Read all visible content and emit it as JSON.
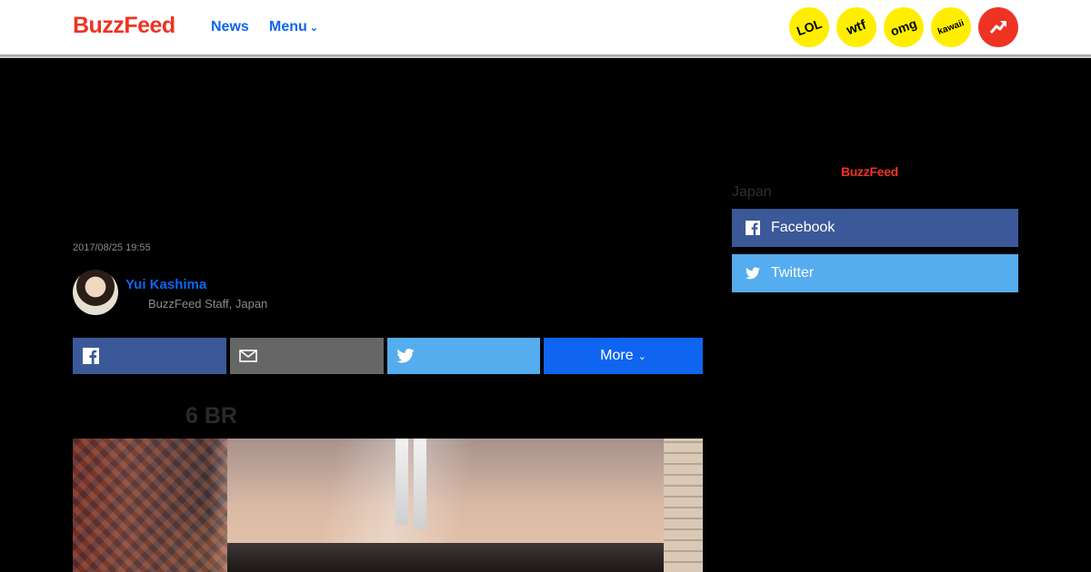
{
  "header": {
    "logo": "BuzzFeed",
    "nav": {
      "news": "News",
      "menu": "Menu"
    },
    "badges": {
      "lol": "LOL",
      "wtf": "wtf",
      "omg": "omg",
      "kawaii": "kawaii"
    },
    "colors": {
      "brand_red": "#ee3322",
      "link_blue": "#0f65ef",
      "badge_yellow": "#ffee00"
    },
    "icons": {
      "trending": "trending-arrow-icon",
      "menu_chevron": "chevron-down-icon"
    }
  },
  "article": {
    "timestamp": "2017/08/25 19:55",
    "author": {
      "name": "Yui Kashima",
      "role": "BuzzFeed Staff, Japan"
    },
    "share": {
      "more_label": "More",
      "icons": {
        "facebook": "facebook-icon",
        "email": "mail-icon",
        "twitter": "twitter-icon"
      },
      "colors": {
        "facebook": "#3b5998",
        "email": "#666666",
        "twitter": "#55acee",
        "more": "#0f65ef"
      }
    },
    "section_heading": "6 BR"
  },
  "sidebar": {
    "logo": "BuzzFeed",
    "country": "Japan",
    "facebook_label": "Facebook",
    "twitter_label": "Twitter"
  }
}
